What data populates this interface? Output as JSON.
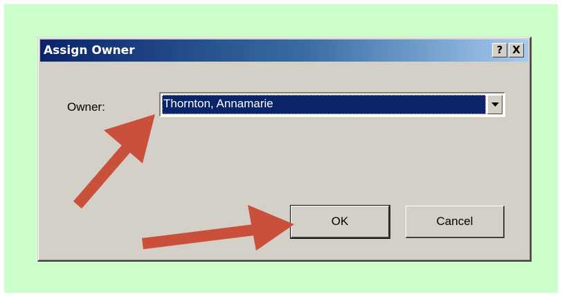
{
  "dialog": {
    "title": "Assign Owner",
    "help_label": "?",
    "close_label": "X"
  },
  "owner": {
    "label": "Owner:",
    "value": "Thornton, Annamarie"
  },
  "buttons": {
    "ok": "OK",
    "cancel": "Cancel"
  },
  "colors": {
    "background": "#ccffcc",
    "dialog_face": "#d4d0c8",
    "title_start": "#0a246a",
    "title_end": "#a6caf0",
    "selection": "#0a246a",
    "annotation_arrow": "#c9503a"
  }
}
